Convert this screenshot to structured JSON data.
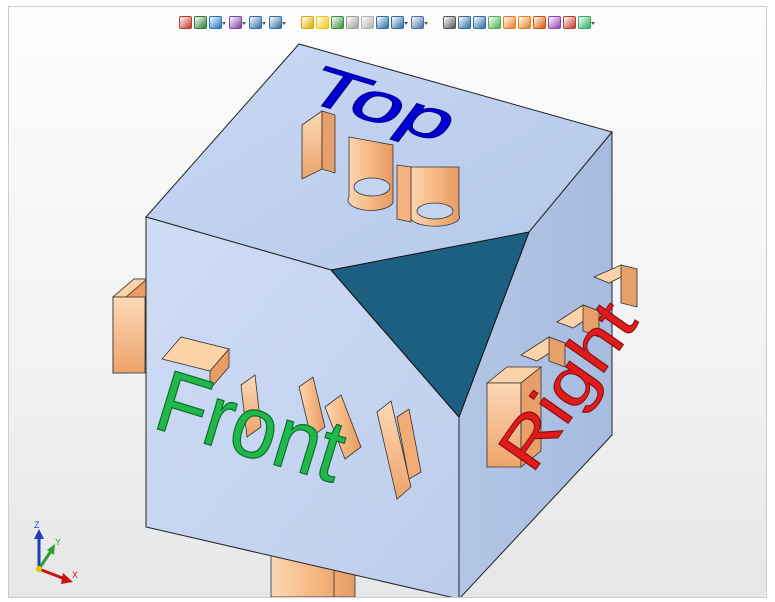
{
  "toolbar": {
    "groups": [
      {
        "name": "selection",
        "buttons": [
          {
            "icon": "select-arrow-icon",
            "color": "#c0392b",
            "dd": false
          },
          {
            "icon": "select-box-icon",
            "color": "#2e7d32",
            "dd": false
          },
          {
            "icon": "select-filter-icon",
            "color": "#1f6fbf",
            "dd": true
          },
          {
            "icon": "select-mode-icon",
            "color": "#7b3fa0",
            "dd": true
          },
          {
            "icon": "pick-icon",
            "color": "#2e6da4",
            "dd": true
          },
          {
            "icon": "window-select-icon",
            "color": "#2e6da4",
            "dd": true
          }
        ]
      },
      {
        "name": "display",
        "buttons": [
          {
            "icon": "light-bulb-icon",
            "color": "#e0a800",
            "dd": false
          },
          {
            "icon": "light-bulb-on-icon",
            "color": "#f1c40f",
            "dd": false
          },
          {
            "icon": "visibility-icon",
            "color": "#3a8f3a",
            "dd": false
          },
          {
            "icon": "pencil-icon",
            "color": "#9e9e9e",
            "dd": false
          },
          {
            "icon": "diamond-icon",
            "color": "#b0b0b0",
            "dd": false
          },
          {
            "icon": "nav-arrow-icon",
            "color": "#2e6da4",
            "dd": false
          },
          {
            "icon": "cube-view-icon",
            "color": "#2e6da4",
            "dd": true
          },
          {
            "icon": "render-mode-icon",
            "color": "#4a6fa5",
            "dd": true
          }
        ]
      },
      {
        "name": "tools",
        "buttons": [
          {
            "icon": "undo-icon",
            "color": "#555555",
            "dd": false
          },
          {
            "icon": "dimension-icon",
            "color": "#2e6da4",
            "dd": false
          },
          {
            "icon": "angle-icon",
            "color": "#2e6da4",
            "dd": false
          },
          {
            "icon": "measure-icon",
            "color": "#4caf50",
            "dd": false
          },
          {
            "icon": "edge-icon",
            "color": "#e67e22",
            "dd": false
          },
          {
            "icon": "face-icon",
            "color": "#e67e22",
            "dd": false
          },
          {
            "icon": "vertex-icon",
            "color": "#d35400",
            "dd": false
          },
          {
            "icon": "section-icon",
            "color": "#8e44ad",
            "dd": false
          },
          {
            "icon": "filter-icon",
            "color": "#c0392b",
            "dd": false
          },
          {
            "icon": "snap-icon",
            "color": "#27ae60",
            "dd": true
          }
        ]
      }
    ]
  },
  "model": {
    "labels": {
      "top": "Top",
      "front": "Front",
      "right": "Right"
    },
    "colors": {
      "top_face": "#bccfee",
      "front_face": "#c6d6f2",
      "right_face": "#afc2e4",
      "cut_face": "#1c5f80",
      "extrusion": "#f7be8c",
      "top_text": "#0000d4",
      "front_text": "#1fb84a",
      "right_text": "#e01b1b"
    }
  },
  "triad": {
    "x": "X",
    "y": "Y",
    "z": "Z"
  }
}
